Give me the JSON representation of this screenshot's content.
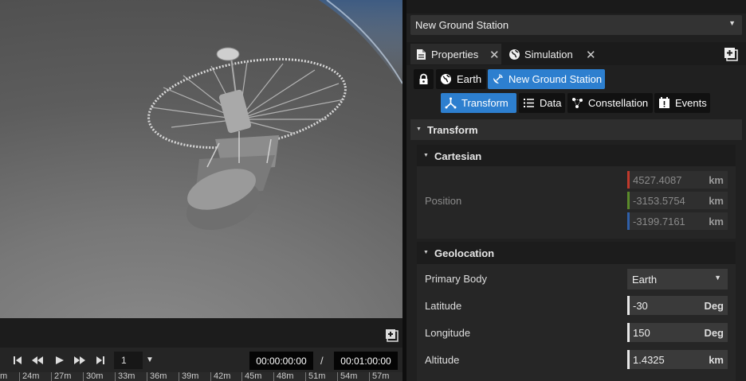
{
  "object_selector": {
    "value": "New Ground Station"
  },
  "tabs": [
    {
      "label": "Properties",
      "icon": "document-icon"
    },
    {
      "label": "Simulation",
      "icon": "globe-icon"
    }
  ],
  "breadcrumb": [
    {
      "label": "",
      "icon": "lock-icon"
    },
    {
      "label": "Earth",
      "icon": "globe-icon"
    },
    {
      "label": "New Ground Station",
      "icon": "satellite-dish-icon",
      "active": true
    }
  ],
  "subtabs": [
    {
      "label": "Transform",
      "icon": "axes-icon",
      "active": true
    },
    {
      "label": "Data",
      "icon": "list-icon"
    },
    {
      "label": "Constellation",
      "icon": "satellites-icon"
    },
    {
      "label": "Events",
      "icon": "events-icon"
    }
  ],
  "transform": {
    "header": "Transform",
    "cartesian": {
      "header": "Cartesian",
      "position_label": "Position",
      "x": {
        "value": "4527.4087",
        "unit": "km",
        "color": "#c0392b"
      },
      "y": {
        "value": "-3153.5754",
        "unit": "km",
        "color": "#5a8a2a"
      },
      "z": {
        "value": "-3199.7161",
        "unit": "km",
        "color": "#2f5fa8"
      }
    },
    "geolocation": {
      "header": "Geolocation",
      "primary_body_label": "Primary Body",
      "primary_body_value": "Earth",
      "latitude_label": "Latitude",
      "latitude_value": "-30",
      "latitude_unit": "Deg",
      "longitude_label": "Longitude",
      "longitude_value": "150",
      "longitude_unit": "Deg",
      "altitude_label": "Altitude",
      "altitude_value": "1.4325",
      "altitude_unit": "km"
    }
  },
  "playback": {
    "speed": "1",
    "current_time": "00:00:00:00",
    "separator": "/",
    "end_time": "00:01:00:00"
  },
  "timeline_ticks": [
    "m",
    "24m",
    "27m",
    "30m",
    "33m",
    "36m",
    "39m",
    "42m",
    "45m",
    "48m",
    "51m",
    "54m",
    "57m"
  ],
  "colors": {
    "accent": "#2d7fcf",
    "panel_bg": "#202020"
  }
}
